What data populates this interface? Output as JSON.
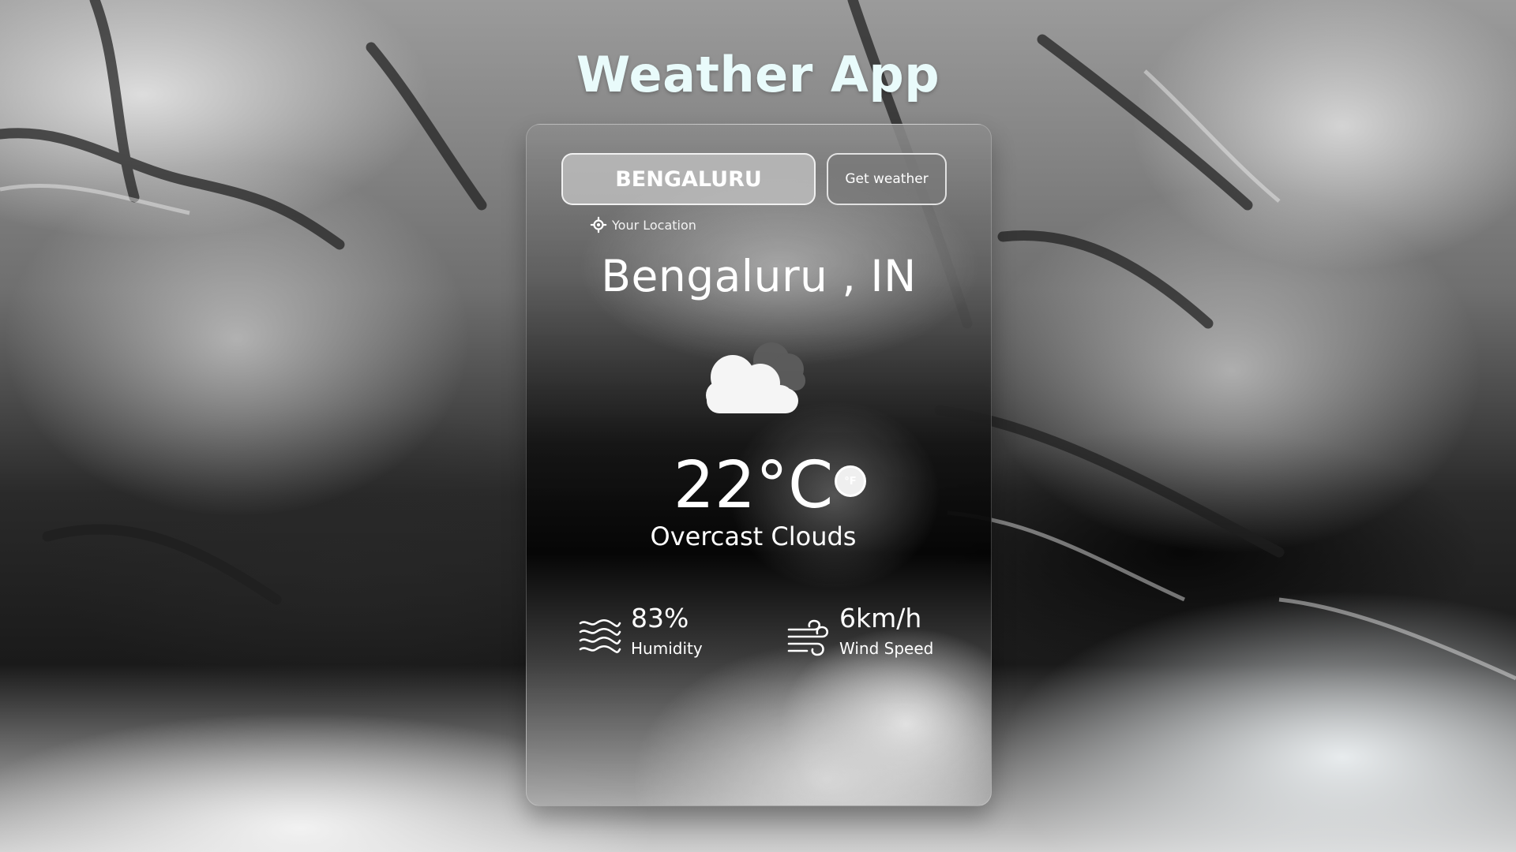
{
  "app": {
    "title": "Weather App"
  },
  "search": {
    "city_value": "BENGALURU",
    "placeholder": "",
    "button_label": "Get weather",
    "location_label": "Your Location"
  },
  "weather": {
    "city": "Bengaluru , IN",
    "temperature": "22°C",
    "unit_toggle_label": "°F",
    "condition": "Overcast Clouds",
    "icon": "cloud-icon"
  },
  "metrics": {
    "humidity": {
      "value": "83%",
      "label": "Humidity",
      "icon": "humidity-waves-icon"
    },
    "wind": {
      "value": "6km/h",
      "label": "Wind Speed",
      "icon": "wind-icon"
    }
  },
  "colors": {
    "title_text": "#e9fbfb",
    "card_text": "#ffffff",
    "input_background": "#bebebe"
  }
}
